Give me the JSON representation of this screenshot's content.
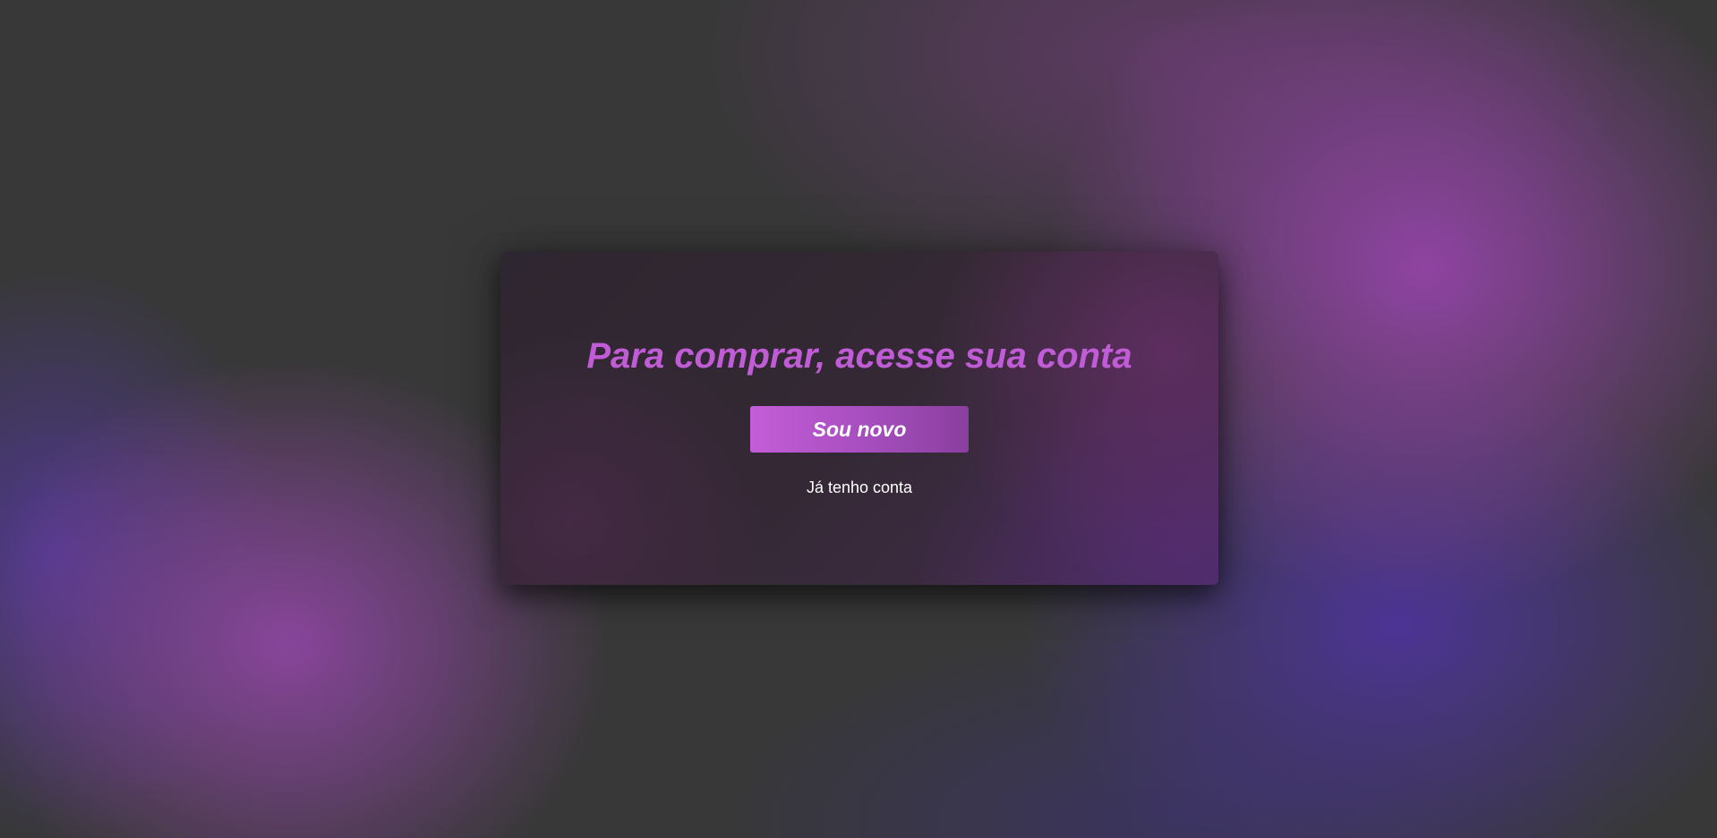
{
  "card": {
    "title": "Para comprar, acesse sua conta",
    "primary_button_label": "Sou novo",
    "secondary_link_label": "Já tenho conta"
  },
  "colors": {
    "accent": "#c05cd6",
    "button_gradient_start": "#c45dd8",
    "button_gradient_end": "#8a3f9e",
    "page_background": "#383838",
    "link_text": "#ffffff"
  }
}
